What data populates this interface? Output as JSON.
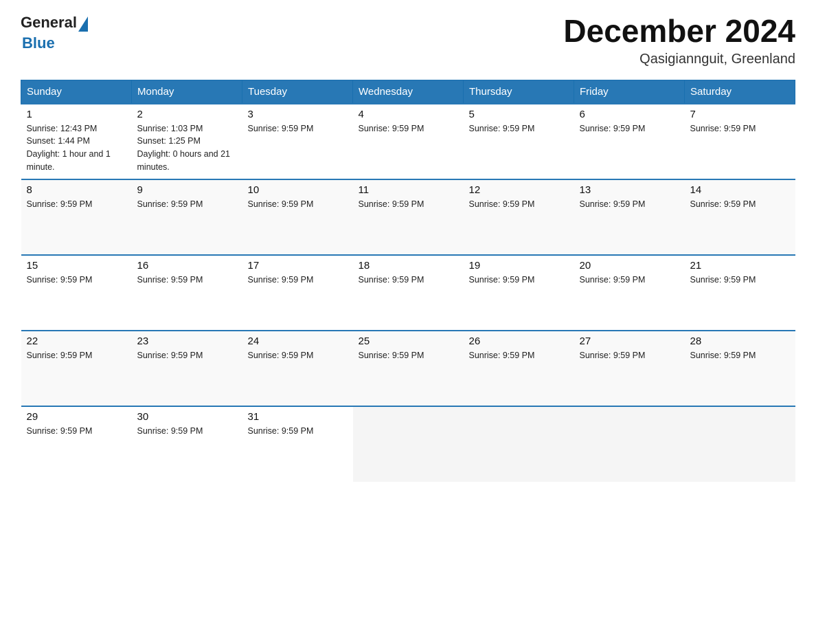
{
  "header": {
    "logo_general": "General",
    "logo_blue": "Blue",
    "month_title": "December 2024",
    "location": "Qasigiannguit, Greenland"
  },
  "days_of_week": [
    "Sunday",
    "Monday",
    "Tuesday",
    "Wednesday",
    "Thursday",
    "Friday",
    "Saturday"
  ],
  "weeks": [
    [
      {
        "day": "1",
        "info": "Sunrise: 12:43 PM\nSunset: 1:44 PM\nDaylight: 1 hour and 1 minute."
      },
      {
        "day": "2",
        "info": "Sunrise: 1:03 PM\nSunset: 1:25 PM\nDaylight: 0 hours and 21 minutes."
      },
      {
        "day": "3",
        "info": "Sunrise: 9:59 PM"
      },
      {
        "day": "4",
        "info": "Sunrise: 9:59 PM"
      },
      {
        "day": "5",
        "info": "Sunrise: 9:59 PM"
      },
      {
        "day": "6",
        "info": "Sunrise: 9:59 PM"
      },
      {
        "day": "7",
        "info": "Sunrise: 9:59 PM"
      }
    ],
    [
      {
        "day": "8",
        "info": "Sunrise: 9:59 PM"
      },
      {
        "day": "9",
        "info": "Sunrise: 9:59 PM"
      },
      {
        "day": "10",
        "info": "Sunrise: 9:59 PM"
      },
      {
        "day": "11",
        "info": "Sunrise: 9:59 PM"
      },
      {
        "day": "12",
        "info": "Sunrise: 9:59 PM"
      },
      {
        "day": "13",
        "info": "Sunrise: 9:59 PM"
      },
      {
        "day": "14",
        "info": "Sunrise: 9:59 PM"
      }
    ],
    [
      {
        "day": "15",
        "info": "Sunrise: 9:59 PM"
      },
      {
        "day": "16",
        "info": "Sunrise: 9:59 PM"
      },
      {
        "day": "17",
        "info": "Sunrise: 9:59 PM"
      },
      {
        "day": "18",
        "info": "Sunrise: 9:59 PM"
      },
      {
        "day": "19",
        "info": "Sunrise: 9:59 PM"
      },
      {
        "day": "20",
        "info": "Sunrise: 9:59 PM"
      },
      {
        "day": "21",
        "info": "Sunrise: 9:59 PM"
      }
    ],
    [
      {
        "day": "22",
        "info": "Sunrise: 9:59 PM"
      },
      {
        "day": "23",
        "info": "Sunrise: 9:59 PM"
      },
      {
        "day": "24",
        "info": "Sunrise: 9:59 PM"
      },
      {
        "day": "25",
        "info": "Sunrise: 9:59 PM"
      },
      {
        "day": "26",
        "info": "Sunrise: 9:59 PM"
      },
      {
        "day": "27",
        "info": "Sunrise: 9:59 PM"
      },
      {
        "day": "28",
        "info": "Sunrise: 9:59 PM"
      }
    ],
    [
      {
        "day": "29",
        "info": "Sunrise: 9:59 PM"
      },
      {
        "day": "30",
        "info": "Sunrise: 9:59 PM"
      },
      {
        "day": "31",
        "info": "Sunrise: 9:59 PM"
      },
      {
        "day": "",
        "info": ""
      },
      {
        "day": "",
        "info": ""
      },
      {
        "day": "",
        "info": ""
      },
      {
        "day": "",
        "info": ""
      }
    ]
  ]
}
